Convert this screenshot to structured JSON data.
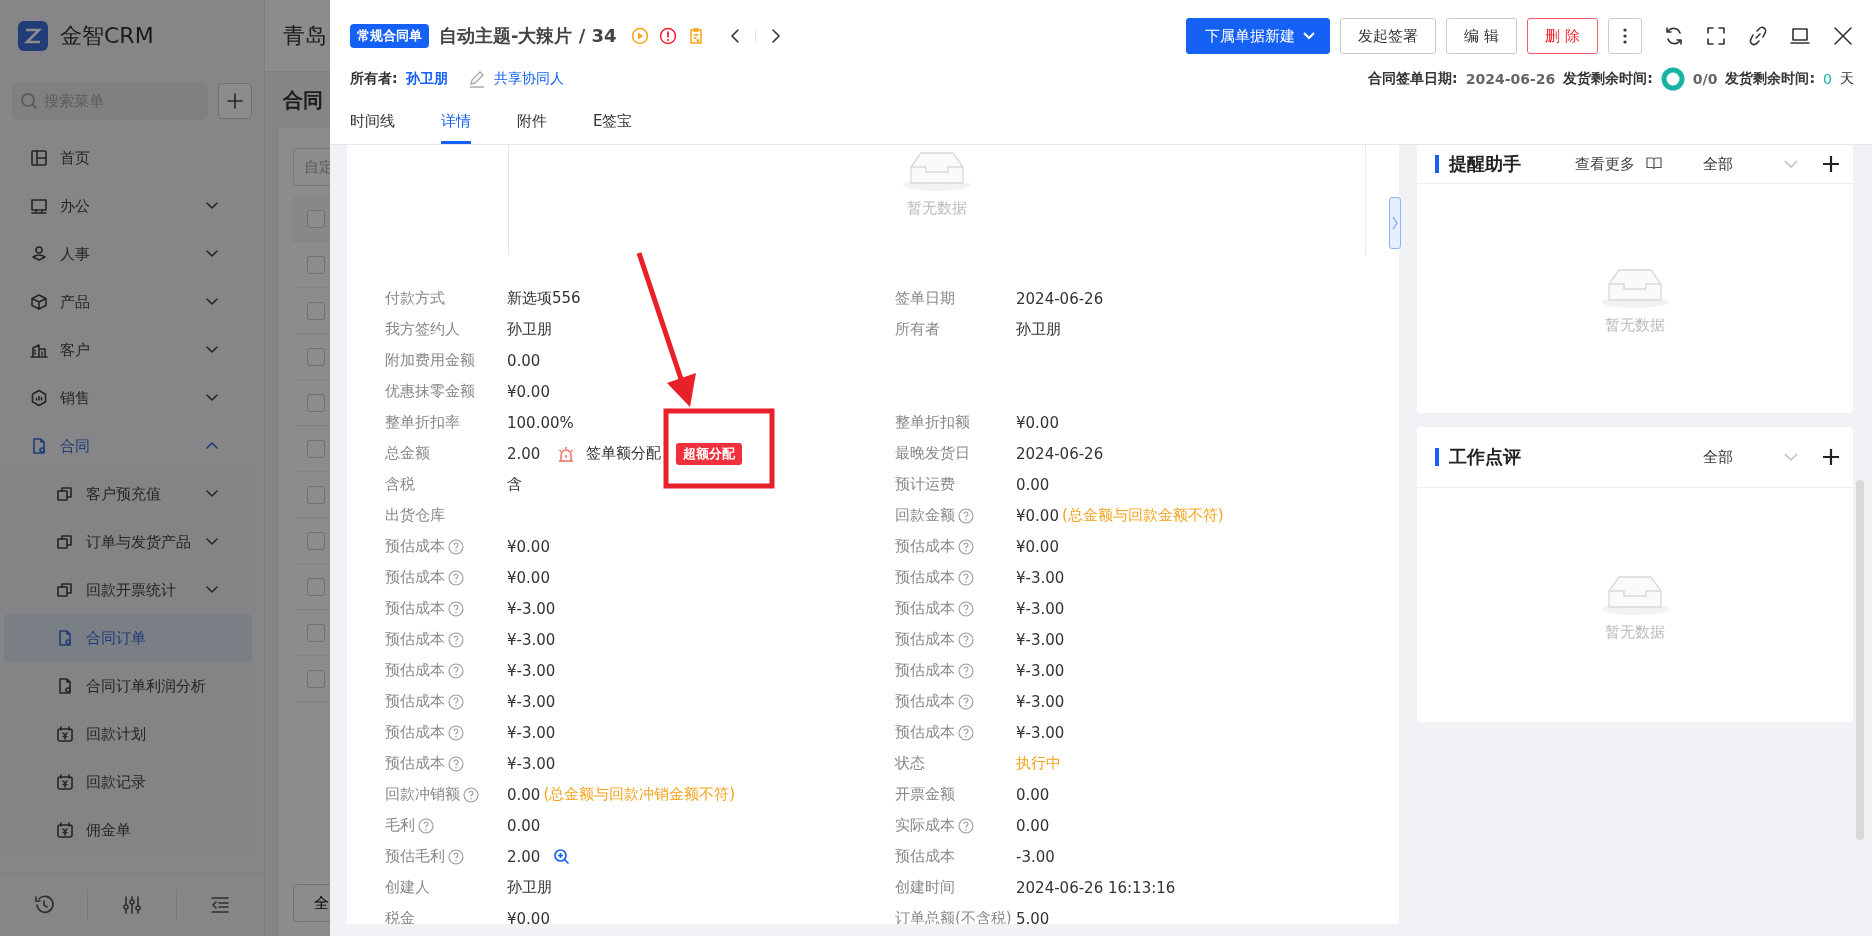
{
  "app": {
    "logo": "金智CRM",
    "company": "青岛"
  },
  "sidebar": {
    "search_placeholder": "搜索菜单",
    "items": [
      {
        "label": "首页",
        "kind": "link",
        "selected": false
      },
      {
        "label": "办公",
        "kind": "group",
        "expanded": false,
        "selected": false
      },
      {
        "label": "人事",
        "kind": "group",
        "expanded": false,
        "selected": false
      },
      {
        "label": "产品",
        "kind": "group",
        "expanded": false,
        "selected": false
      },
      {
        "label": "客户",
        "kind": "group",
        "expanded": false,
        "selected": false
      },
      {
        "label": "销售",
        "kind": "group",
        "expanded": false,
        "selected": false
      },
      {
        "label": "合同",
        "kind": "group",
        "expanded": true,
        "selected": false,
        "children": [
          {
            "label": "客户预充值",
            "kind": "group",
            "expanded": false,
            "selected": false
          },
          {
            "label": "订单与发货产品",
            "kind": "group",
            "expanded": false,
            "selected": false
          },
          {
            "label": "回款开票统计",
            "kind": "group",
            "expanded": false,
            "selected": false
          },
          {
            "label": "合同订单",
            "kind": "link",
            "selected": true
          },
          {
            "label": "合同订单利润分析",
            "kind": "link",
            "selected": false
          },
          {
            "label": "回款计划",
            "kind": "link",
            "selected": false
          },
          {
            "label": "回款记录",
            "kind": "link",
            "selected": false
          },
          {
            "label": "佣金单",
            "kind": "link",
            "selected": false
          }
        ]
      }
    ]
  },
  "main": {
    "title": "合同",
    "filter_placeholder": "自定",
    "footer_button": "全",
    "checkbox_rows": [
      {
        "checked": false
      },
      {
        "checked": false
      },
      {
        "checked": false
      },
      {
        "checked": false
      },
      {
        "checked": false
      },
      {
        "checked": false
      },
      {
        "checked": false
      },
      {
        "checked": false
      },
      {
        "checked": false
      },
      {
        "checked": false
      },
      {
        "checked": false
      }
    ]
  },
  "drawer": {
    "type_tag": "常规合同单",
    "title": "自动主题-大辣片 / 34",
    "actions": [
      {
        "label": "下属单据新建",
        "kind": "primary-dropdown"
      },
      {
        "label": "发起签署",
        "kind": "default"
      },
      {
        "label": "编 辑",
        "kind": "default"
      },
      {
        "label": "删 除",
        "kind": "danger"
      }
    ],
    "owner_label": "所有者:",
    "owner": "孙卫朋",
    "share_link": "共享协同人",
    "sign_date_label": "合同签单日期:",
    "sign_date": "2024-06-26",
    "delivery_label": "发货剩余时间:",
    "delivery_progress": "0/0",
    "delivery_days_label": "发货剩余时间:",
    "delivery_days": "0",
    "days_unit": "天",
    "tabs": [
      {
        "label": "时间线",
        "selected": false
      },
      {
        "label": "详情",
        "selected": true
      },
      {
        "label": "附件",
        "selected": false
      },
      {
        "label": "E签宝",
        "selected": false
      }
    ],
    "empty_text": "暂无数据",
    "rows": [
      [
        {
          "label": "付款方式",
          "help": false,
          "kind": "text",
          "value": "新选项556"
        },
        {
          "label": "签单日期",
          "help": false,
          "kind": "text",
          "value": "2024-06-26"
        }
      ],
      [
        {
          "label": "我方签约人",
          "help": false,
          "kind": "text",
          "value": "孙卫朋"
        },
        {
          "label": "所有者",
          "help": false,
          "kind": "text",
          "value": "孙卫朋"
        }
      ],
      [
        {
          "label": "附加费用金额",
          "help": false,
          "kind": "text",
          "value": "0.00"
        }
      ],
      [
        {
          "label": "优惠抹零金额",
          "help": false,
          "kind": "text",
          "value": "¥0.00"
        }
      ],
      [
        {
          "label": "整单折扣率",
          "help": false,
          "kind": "text",
          "value": "100.00%"
        },
        {
          "label": "整单折扣额",
          "help": false,
          "kind": "text",
          "value": "¥0.00"
        }
      ],
      [
        {
          "label": "总金额",
          "help": false,
          "kind": "allocation",
          "value": "2.00",
          "allocation_label": "签单额分配",
          "badge": "超额分配"
        },
        {
          "label": "最晚发货日",
          "help": false,
          "kind": "text",
          "value": "2024-06-26"
        }
      ],
      [
        {
          "label": "含税",
          "help": false,
          "kind": "text",
          "value": "含"
        },
        {
          "label": "预计运费",
          "help": false,
          "kind": "text",
          "value": "0.00"
        }
      ],
      [
        {
          "label": "出货仓库",
          "help": false,
          "kind": "text"
        },
        {
          "label": "回款金额",
          "help": true,
          "kind": "text",
          "value": "¥0.00",
          "note": "(总金额与回款金额不符)"
        }
      ],
      [
        {
          "label": "预估成本",
          "help": true,
          "kind": "text",
          "value": "¥0.00"
        },
        {
          "label": "预估成本",
          "help": true,
          "kind": "text",
          "value": "¥0.00"
        }
      ],
      [
        {
          "label": "预估成本",
          "help": true,
          "kind": "text",
          "value": "¥0.00"
        },
        {
          "label": "预估成本",
          "help": true,
          "kind": "text",
          "value": "¥-3.00"
        }
      ],
      [
        {
          "label": "预估成本",
          "help": true,
          "kind": "text",
          "value": "¥-3.00"
        },
        {
          "label": "预估成本",
          "help": true,
          "kind": "text",
          "value": "¥-3.00"
        }
      ],
      [
        {
          "label": "预估成本",
          "help": true,
          "kind": "text",
          "value": "¥-3.00"
        },
        {
          "label": "预估成本",
          "help": true,
          "kind": "text",
          "value": "¥-3.00"
        }
      ],
      [
        {
          "label": "预估成本",
          "help": true,
          "kind": "text",
          "value": "¥-3.00"
        },
        {
          "label": "预估成本",
          "help": true,
          "kind": "text",
          "value": "¥-3.00"
        }
      ],
      [
        {
          "label": "预估成本",
          "help": true,
          "kind": "text",
          "value": "¥-3.00"
        },
        {
          "label": "预估成本",
          "help": true,
          "kind": "text",
          "value": "¥-3.00"
        }
      ],
      [
        {
          "label": "预估成本",
          "help": true,
          "kind": "text",
          "value": "¥-3.00"
        },
        {
          "label": "预估成本",
          "help": true,
          "kind": "text",
          "value": "¥-3.00"
        }
      ],
      [
        {
          "label": "预估成本",
          "help": true,
          "kind": "text",
          "value": "¥-3.00"
        },
        {
          "label": "状态",
          "help": false,
          "kind": "status",
          "value": "执行中"
        }
      ],
      [
        {
          "label": "回款冲销额",
          "help": true,
          "kind": "text",
          "value": "0.00",
          "note": "(总金额与回款冲销金额不符)"
        },
        {
          "label": "开票金额",
          "help": false,
          "kind": "text",
          "value": "0.00"
        }
      ],
      [
        {
          "label": "毛利",
          "help": true,
          "kind": "text",
          "value": "0.00"
        },
        {
          "label": "实际成本",
          "help": true,
          "kind": "text",
          "value": "0.00"
        }
      ],
      [
        {
          "label": "预估毛利",
          "help": true,
          "kind": "zoom",
          "value": "2.00"
        },
        {
          "label": "预估成本",
          "help": false,
          "kind": "text",
          "value": "-3.00"
        }
      ],
      [
        {
          "label": "创建人",
          "help": false,
          "kind": "text",
          "value": "孙卫朋"
        },
        {
          "label": "创建时间",
          "help": false,
          "kind": "text",
          "value": "2024-06-26 16:13:16"
        }
      ],
      [
        {
          "label": "税金",
          "help": false,
          "kind": "text",
          "value": "¥0.00"
        },
        {
          "label": "订单总额(不含税)",
          "help": false,
          "kind": "text",
          "value": "5.00"
        }
      ]
    ]
  },
  "side_panel": {
    "cards": [
      {
        "title": "提醒助手",
        "more_link": "查看更多",
        "filter": "全部",
        "empty_text": "暂无数据"
      },
      {
        "title": "工作点评",
        "filter": "全部",
        "empty_text": "暂无数据"
      }
    ]
  }
}
